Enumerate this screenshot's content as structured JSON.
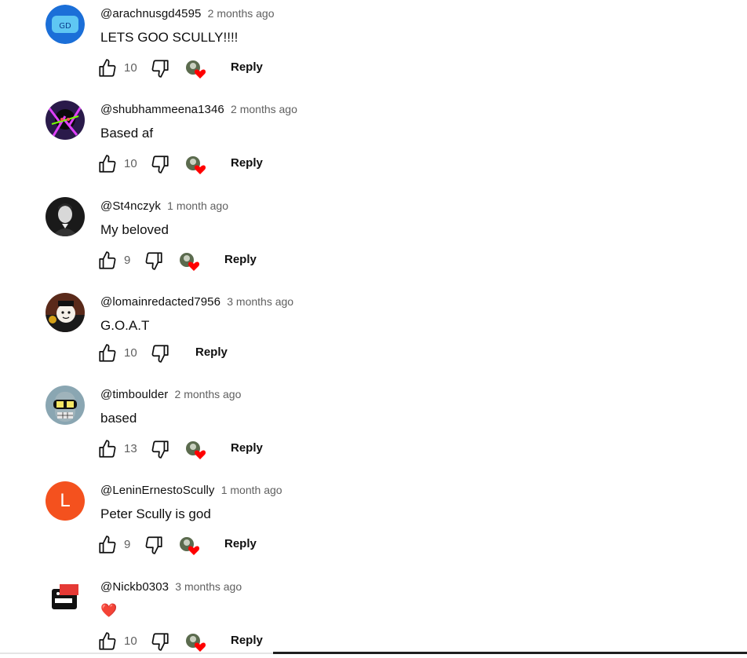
{
  "comments": [
    {
      "author": "@arachnusgd4595",
      "time": "2 months ago",
      "text": "LETS GOO SCULLY!!!!",
      "likes": "10",
      "hearted": true,
      "reply": "Reply"
    },
    {
      "author": "@shubhammeena1346",
      "time": "2 months ago",
      "text": "Based af",
      "likes": "10",
      "hearted": true,
      "reply": "Reply"
    },
    {
      "author": "@St4nczyk",
      "time": "1 month ago",
      "text": "My beloved",
      "likes": "9",
      "hearted": true,
      "reply": "Reply"
    },
    {
      "author": "@lomainredacted7956",
      "time": "3 months ago",
      "text": "G.O.A.T",
      "likes": "10",
      "hearted": false,
      "reply": "Reply"
    },
    {
      "author": "@timboulder",
      "time": "2 months ago",
      "text": "based",
      "likes": "13",
      "hearted": true,
      "reply": "Reply"
    },
    {
      "author": "@LeninErnestoScully",
      "time": "1 month ago",
      "text": "Peter Scully is god",
      "likes": "9",
      "hearted": true,
      "reply": "Reply",
      "avatar_letter": "L"
    },
    {
      "author": "@Nickb0303",
      "time": "3 months ago",
      "text": "❤️",
      "likes": "10",
      "hearted": true,
      "reply": "Reply"
    }
  ],
  "colors": {
    "avatar_letter_bg": "#f4511e",
    "heart": "#ff0000",
    "meta_text": "#606060"
  }
}
